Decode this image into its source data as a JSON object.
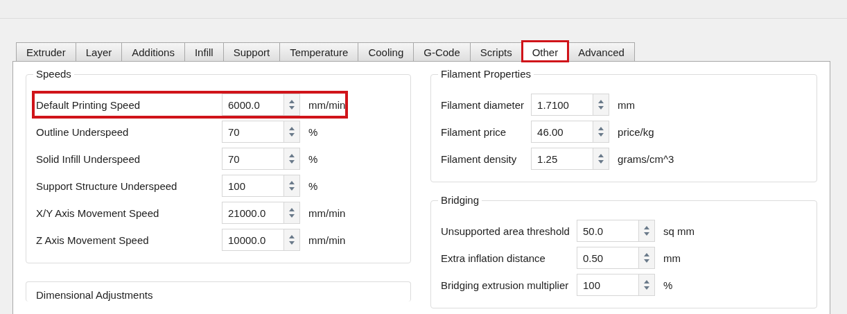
{
  "tabs": [
    {
      "label": "Extruder",
      "selected": false,
      "highlighted": false
    },
    {
      "label": "Layer",
      "selected": false,
      "highlighted": false
    },
    {
      "label": "Additions",
      "selected": false,
      "highlighted": false
    },
    {
      "label": "Infill",
      "selected": false,
      "highlighted": false
    },
    {
      "label": "Support",
      "selected": false,
      "highlighted": false
    },
    {
      "label": "Temperature",
      "selected": false,
      "highlighted": false
    },
    {
      "label": "Cooling",
      "selected": false,
      "highlighted": false
    },
    {
      "label": "G-Code",
      "selected": false,
      "highlighted": false
    },
    {
      "label": "Scripts",
      "selected": false,
      "highlighted": false
    },
    {
      "label": "Other",
      "selected": true,
      "highlighted": true
    },
    {
      "label": "Advanced",
      "selected": false,
      "highlighted": false
    }
  ],
  "left_column": [
    {
      "title": "Speeds",
      "fields": [
        {
          "label": "Default Printing Speed",
          "value": "6000.0",
          "unit": "mm/min",
          "highlighted": true
        },
        {
          "label": "Outline Underspeed",
          "value": "70",
          "unit": "%",
          "highlighted": false
        },
        {
          "label": "Solid Infill Underspeed",
          "value": "70",
          "unit": "%",
          "highlighted": false
        },
        {
          "label": "Support Structure Underspeed",
          "value": "100",
          "unit": "%",
          "highlighted": false
        },
        {
          "label": "X/Y Axis Movement Speed",
          "value": "21000.0",
          "unit": "mm/min",
          "highlighted": false
        },
        {
          "label": "Z Axis Movement Speed",
          "value": "10000.0",
          "unit": "mm/min",
          "highlighted": false
        }
      ]
    },
    {
      "title": "Dimensional Adjustments"
    }
  ],
  "right_column": [
    {
      "title": "Filament Properties",
      "fields": [
        {
          "label": "Filament diameter",
          "value": "1.7100",
          "unit": "mm",
          "highlighted": false
        },
        {
          "label": "Filament price",
          "value": "46.00",
          "unit": "price/kg",
          "highlighted": false
        },
        {
          "label": "Filament density",
          "value": "1.25",
          "unit": "grams/cm^3",
          "highlighted": false
        }
      ]
    },
    {
      "title": "Bridging",
      "fields": [
        {
          "label": "Unsupported area threshold",
          "value": "50.0",
          "unit": "sq mm",
          "highlighted": false
        },
        {
          "label": "Extra inflation distance",
          "value": "0.50",
          "unit": "mm",
          "highlighted": false
        },
        {
          "label": "Bridging extrusion multiplier",
          "value": "100",
          "unit": "%",
          "highlighted": false
        }
      ]
    }
  ]
}
